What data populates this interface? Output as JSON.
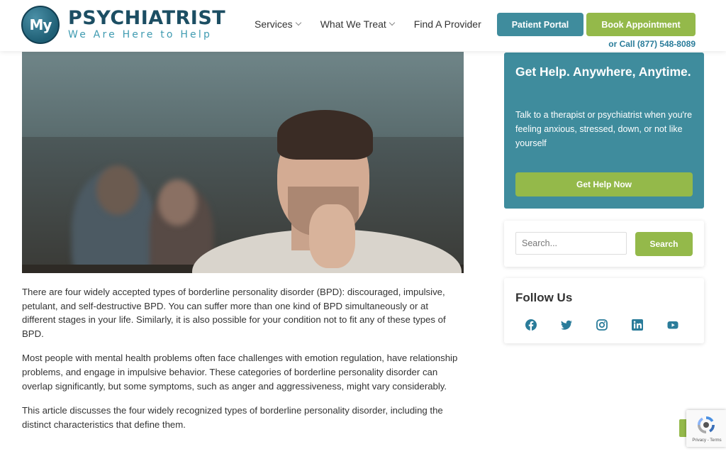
{
  "header": {
    "logo_mark": "My",
    "logo_title": "PSYCHIATRIST",
    "logo_tagline": "We Are Here to Help",
    "nav": [
      {
        "label": "Services",
        "has_dropdown": true
      },
      {
        "label": "What We Treat",
        "has_dropdown": true
      },
      {
        "label": "Find A Provider",
        "has_dropdown": false
      }
    ],
    "portal_button": "Patient Portal",
    "book_button": "Book Appointment",
    "call_text": "or Call (877) 548-8089"
  },
  "article": {
    "paragraphs": [
      "There are four widely accepted types of borderline personality disorder (BPD): discouraged, impulsive, petulant, and self-destructive BPD. You can suffer more than one kind of BPD simultaneously or at different stages in your life. Similarly, it is also possible for your condition not to fit any of these types of BPD.",
      "Most people with mental health problems often face challenges with emotion regulation, have relationship problems, and engage in impulsive behavior. These categories of borderline personality disorder can overlap significantly, but some symptoms, such as anger and aggressiveness, might vary considerably.",
      "This article discusses the four widely recognized types of borderline personality disorder, including the distinct characteristics that define them."
    ]
  },
  "sidebar": {
    "help_title": "Get Help. Anywhere, Anytime.",
    "help_text": "Talk to a therapist or psychiatrist when you're feeling anxious, stressed, down, or not like yourself",
    "help_button": "Get Help Now",
    "search_placeholder": "Search...",
    "search_button": "Search",
    "follow_title": "Follow Us",
    "social_icons": [
      "facebook-icon",
      "twitter-icon",
      "instagram-icon",
      "linkedin-icon",
      "youtube-icon"
    ]
  },
  "recaptcha": {
    "links": "Privacy - Terms"
  },
  "colors": {
    "teal": "#3f8c9d",
    "green": "#94b94a",
    "navy": "#1c4e63",
    "link_blue": "#2a7c9a"
  }
}
